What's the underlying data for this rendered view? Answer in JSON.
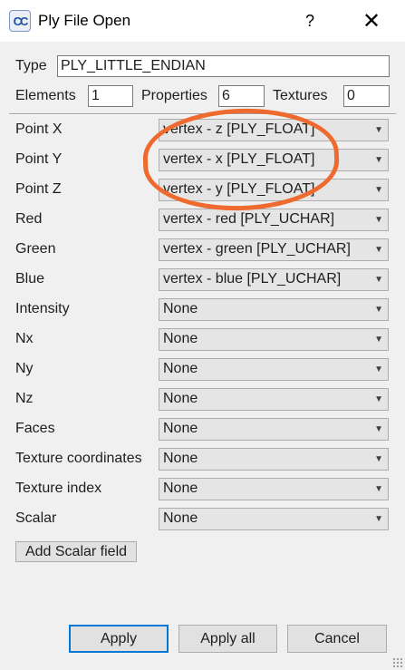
{
  "window": {
    "title": "Ply File Open",
    "icon_text": "CC",
    "help_label": "?",
    "close_label": "✕"
  },
  "header": {
    "type_label": "Type",
    "type_value": "PLY_LITTLE_ENDIAN",
    "elements_label": "Elements",
    "elements_value": "1",
    "properties_label": "Properties",
    "properties_value": "6",
    "textures_label": "Textures",
    "textures_value": "0"
  },
  "fields": [
    {
      "label": "Point X",
      "value": "vertex - z [PLY_FLOAT]"
    },
    {
      "label": "Point Y",
      "value": "vertex - x [PLY_FLOAT]"
    },
    {
      "label": "Point Z",
      "value": "vertex - y [PLY_FLOAT]"
    },
    {
      "label": "Red",
      "value": "vertex - red [PLY_UCHAR]"
    },
    {
      "label": "Green",
      "value": "vertex - green [PLY_UCHAR]"
    },
    {
      "label": "Blue",
      "value": "vertex - blue [PLY_UCHAR]"
    },
    {
      "label": "Intensity",
      "value": "None"
    },
    {
      "label": "Nx",
      "value": "None"
    },
    {
      "label": "Ny",
      "value": "None"
    },
    {
      "label": "Nz",
      "value": "None"
    },
    {
      "label": "Faces",
      "value": "None"
    },
    {
      "label": "Texture coordinates",
      "value": "None"
    },
    {
      "label": "Texture index",
      "value": "None"
    },
    {
      "label": "Scalar",
      "value": "None"
    }
  ],
  "add_scalar_label": "Add Scalar field",
  "buttons": {
    "apply": "Apply",
    "apply_all": "Apply all",
    "cancel": "Cancel"
  },
  "annotation_color": "#ef6a2e",
  "accent_color": "#0078d7"
}
